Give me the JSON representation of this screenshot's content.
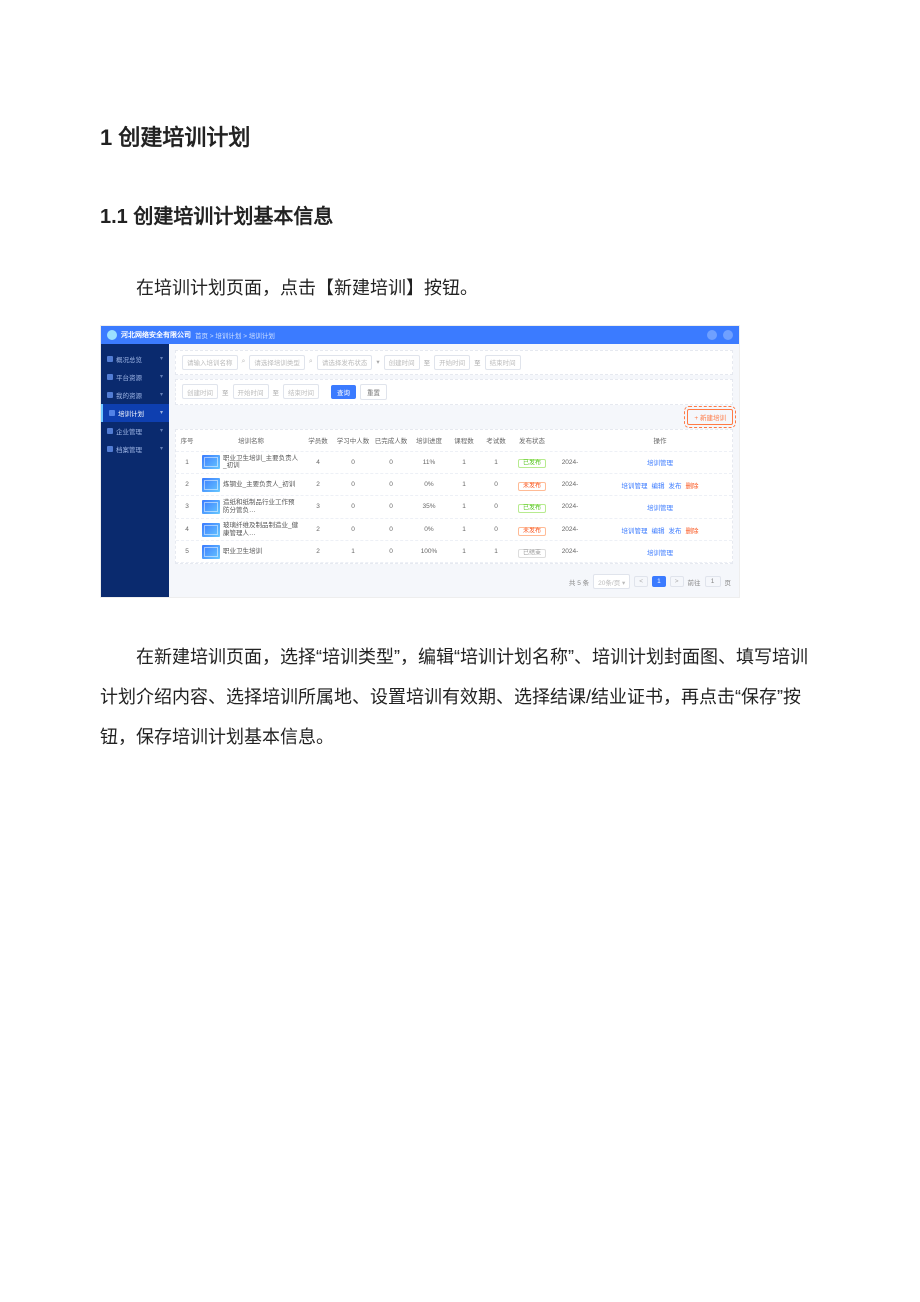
{
  "doc": {
    "h1": "1  创建培训计划",
    "h2": "1.1 创建培训计划基本信息",
    "p1": "在培训计划页面，点击【新建培训】按钮。",
    "p2": "在新建培训页面，选择“培训类型”，编辑“培训计划名称”、培训计划封面图、填写培训计划介绍内容、选择培训所属地、设置培训有效期、选择结课/结业证书，再点击“保存”按钮，保存培训计划基本信息。"
  },
  "app": {
    "brand": "河北网络安全有限公司",
    "breadcrumb": "首页 > 培训计划 > 培训计划",
    "sidebar": [
      {
        "label": "概况总览"
      },
      {
        "label": "平台资源"
      },
      {
        "label": "我的资源"
      },
      {
        "label": "培训计划",
        "active": true
      },
      {
        "label": "企业管理"
      },
      {
        "label": "档案管理"
      }
    ],
    "filter": {
      "input_org_ph": "请输入培训名称",
      "input_type_ph": "请选择培训类型",
      "input_status_ph": "请选择发布状态",
      "date_create_ph": "创建时间",
      "date_start_ph": "开始时间",
      "date_end_ph": "结束时间",
      "to": "至",
      "search_btn": "查询",
      "reset_btn": "重置"
    },
    "new_btn": "+ 新建培训",
    "table": {
      "headers": {
        "idx": "序号",
        "name": "培训名称",
        "members": "学员数",
        "learning": "学习中人数",
        "done": "已完成人数",
        "progress": "培训进度",
        "courses": "课程数",
        "exams": "考试数",
        "status": "发布状态",
        "ops": "操作"
      },
      "status_map": {
        "published": "已发布",
        "unpublished": "未发布",
        "ended": "已结束"
      },
      "ops_map": {
        "manage": "培训管理",
        "edit": "编辑",
        "publish": "发布",
        "delete": "删除"
      },
      "rows": [
        {
          "idx": "1",
          "name": "职业卫生培训_主要负责人_初训",
          "members": "4",
          "learning": "0",
          "done": "0",
          "progress": "11%",
          "courses": "1",
          "exams": "1",
          "status": "published",
          "year": "2024-",
          "ops": [
            "manage"
          ]
        },
        {
          "idx": "2",
          "name": "炼钢业_主要负责人_初训",
          "members": "2",
          "learning": "0",
          "done": "0",
          "progress": "0%",
          "courses": "1",
          "exams": "0",
          "status": "unpublished",
          "year": "2024-",
          "ops": [
            "manage",
            "edit",
            "publish",
            "delete"
          ]
        },
        {
          "idx": "3",
          "name": "造纸和纸制品行业工作预防分管负…",
          "members": "3",
          "learning": "0",
          "done": "0",
          "progress": "35%",
          "courses": "1",
          "exams": "0",
          "status": "published",
          "year": "2024-",
          "ops": [
            "manage"
          ]
        },
        {
          "idx": "4",
          "name": "玻璃纤维及制品制造业_健康管理人…",
          "members": "2",
          "learning": "0",
          "done": "0",
          "progress": "0%",
          "courses": "1",
          "exams": "0",
          "status": "unpublished",
          "year": "2024-",
          "ops": [
            "manage",
            "edit",
            "publish",
            "delete"
          ]
        },
        {
          "idx": "5",
          "name": "职业卫生培训",
          "members": "2",
          "learning": "1",
          "done": "0",
          "progress": "100%",
          "courses": "1",
          "exams": "1",
          "status": "ended",
          "year": "2024-",
          "ops": [
            "manage"
          ]
        }
      ]
    },
    "pager": {
      "total": "共 5 条",
      "size": "20条/页",
      "current": "1",
      "goto": "前往",
      "goto_val": "1",
      "page_suffix": "页"
    }
  }
}
